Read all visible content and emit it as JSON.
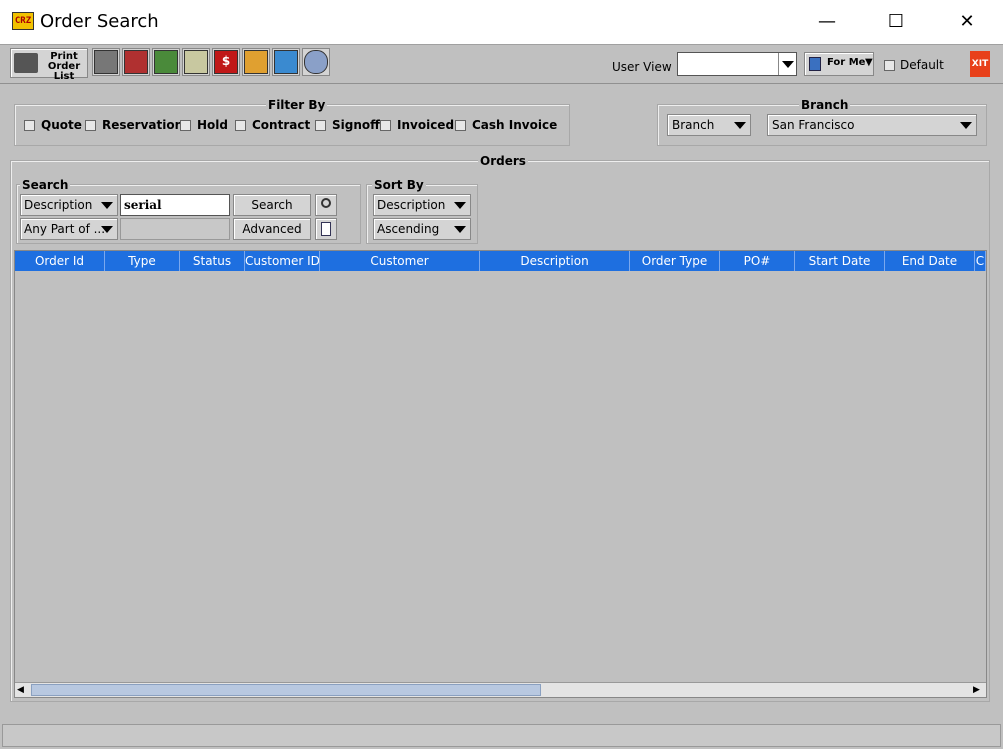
{
  "window": {
    "title": "Order Search",
    "logo_text": "CRZ",
    "minimize": "—",
    "maximize": "☐",
    "close": "✕"
  },
  "toolbar": {
    "print_label_1": "Print",
    "print_label_2": "Order List",
    "user_view_label": "User View",
    "user_view_value": "",
    "for_me_label": "For Me",
    "default_label": "Default",
    "exit_label": "XIT"
  },
  "filter": {
    "title": "Filter By",
    "items": [
      "Quote",
      "Reservation",
      "Hold",
      "Contract",
      "Signoff",
      "Invoiced",
      "Cash Invoice"
    ]
  },
  "branch": {
    "title": "Branch",
    "type_value": "Branch",
    "location_value": "San Francisco"
  },
  "orders": {
    "title": "Orders",
    "search": {
      "title": "Search",
      "field_value": "Description",
      "match_value": "Any Part of ...",
      "query_value": "serial",
      "search_button": "Search",
      "advanced_button": "Advanced"
    },
    "sort": {
      "title": "Sort By",
      "field_value": "Description",
      "order_value": "Ascending"
    },
    "columns": [
      "Order Id",
      "Type",
      "Status",
      "Customer ID",
      "Customer",
      "Description",
      "Order Type",
      "PO#",
      "Start Date",
      "End Date",
      "C"
    ]
  },
  "colors": {
    "header_blue": "#1e6fe0",
    "panel_gray": "#c0c0c0"
  }
}
